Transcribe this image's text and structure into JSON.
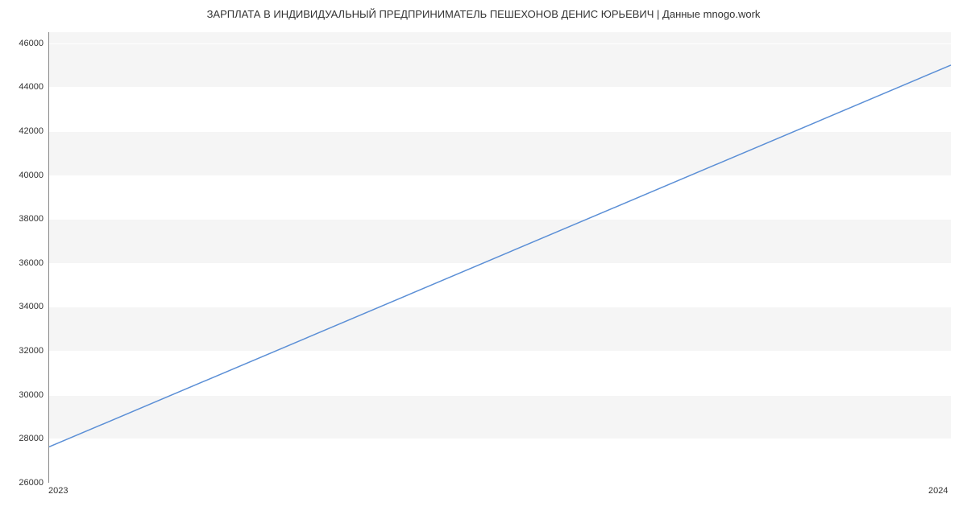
{
  "chart_data": {
    "type": "line",
    "title": "ЗАРПЛАТА В ИНДИВИДУАЛЬНЫЙ ПРЕДПРИНИМАТЕЛЬ ПЕШЕХОНОВ ДЕНИС ЮРЬЕВИЧ | Данные mnogo.work",
    "xlabel": "",
    "ylabel": "",
    "x_categories": [
      "2023",
      "2024"
    ],
    "y_ticks": [
      26000,
      28000,
      30000,
      32000,
      34000,
      36000,
      38000,
      40000,
      42000,
      44000,
      46000
    ],
    "ylim": [
      26000,
      46500
    ],
    "xlim": [
      "2023",
      "2024"
    ],
    "series": [
      {
        "name": "salary",
        "color": "#5b8fd6",
        "x": [
          "2023",
          "2024"
        ],
        "values": [
          27600,
          45000
        ]
      }
    ],
    "grid": true,
    "legend": false
  }
}
